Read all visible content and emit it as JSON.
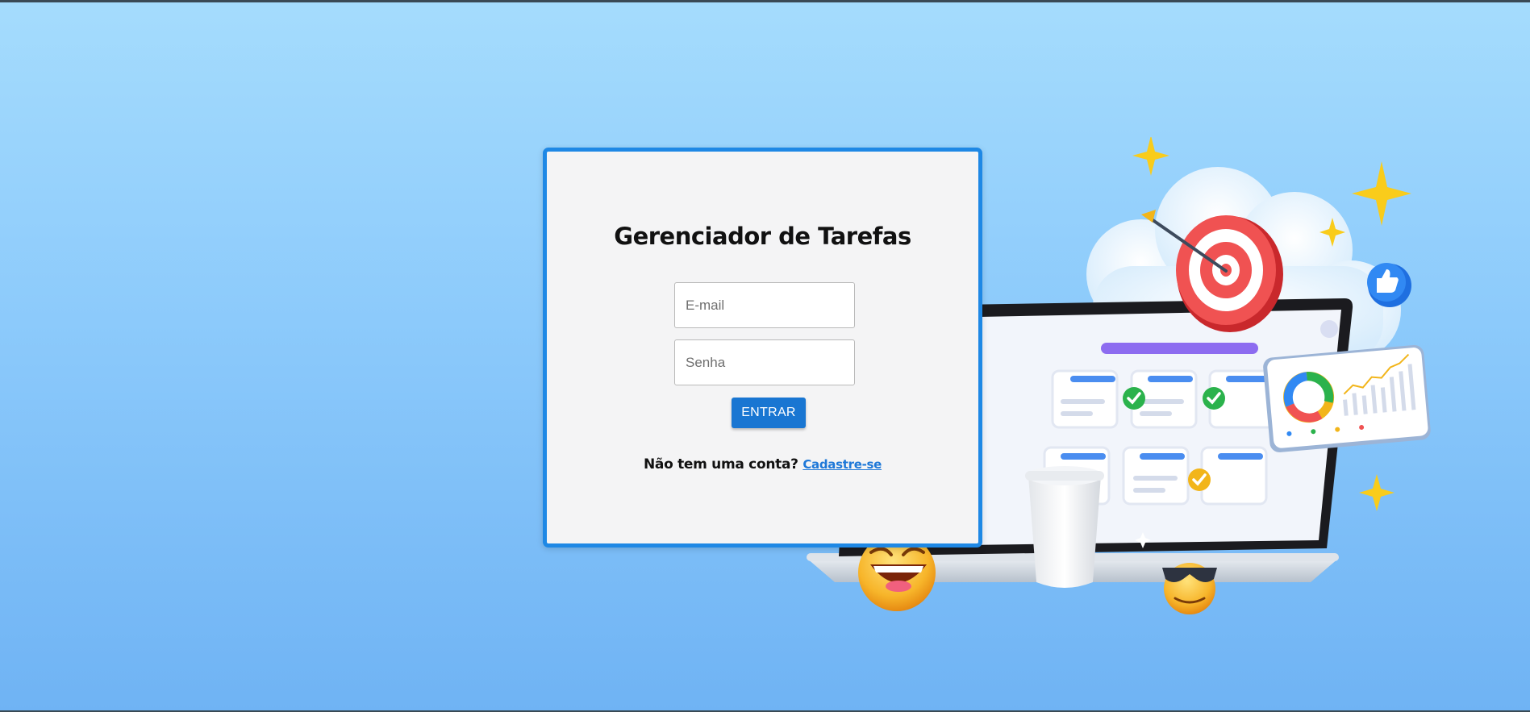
{
  "login": {
    "title": "Gerenciador de Tarefas",
    "email_placeholder": "E-mail",
    "password_placeholder": "Senha",
    "submit_label": "ENTRAR",
    "signup_prompt": "Não tem uma conta?",
    "signup_link": "Cadastre-se"
  },
  "colors": {
    "background_top": "#a5dcfd",
    "background_bottom": "#6fb3f4",
    "card_border": "#1e88e5",
    "card_background": "#f4f4f5",
    "button": "#1976d2",
    "link": "#1e78d8"
  },
  "illustration": {
    "icons": [
      "clock-icon",
      "check-badge-icon",
      "target-icon",
      "arrow-icon",
      "thumbs-up-icon",
      "sparkle-icon",
      "laptop-icon",
      "donut-chart-icon",
      "bar-chart-icon",
      "coffee-cup-icon",
      "laughing-emoji-icon",
      "cool-emoji-icon"
    ]
  }
}
